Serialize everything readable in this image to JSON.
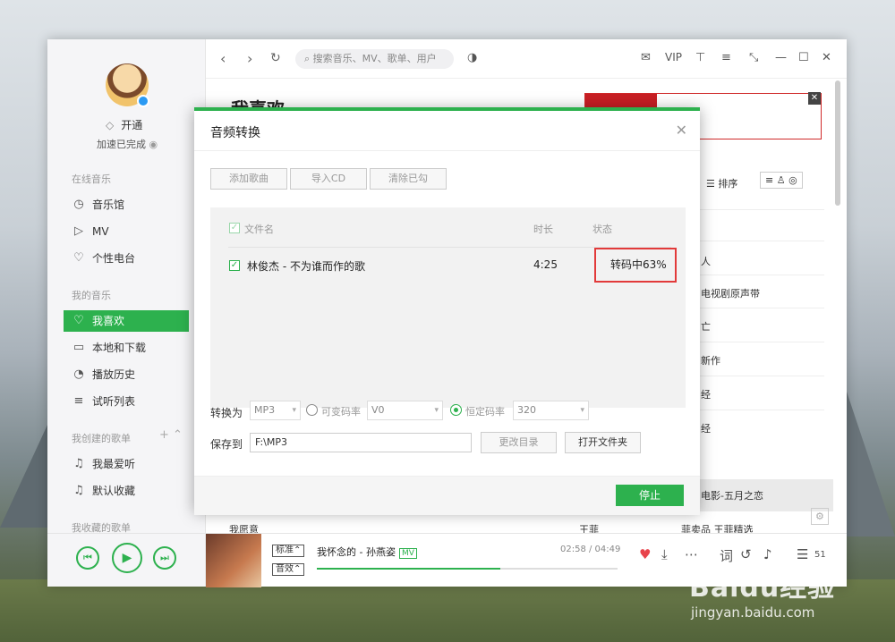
{
  "app": {
    "vip_label": "开通",
    "speed_label": "加速已完成",
    "sections": {
      "online": "在线音乐",
      "mine": "我的音乐",
      "created": "我创建的歌单",
      "collected": "我收藏的歌单"
    },
    "online_items": [
      {
        "label": "音乐馆",
        "icon": "music-hall-icon"
      },
      {
        "label": "MV",
        "icon": "mv-icon"
      },
      {
        "label": "个性电台",
        "icon": "radio-icon"
      }
    ],
    "my_items": [
      {
        "label": "我喜欢",
        "icon": "heart-icon"
      },
      {
        "label": "本地和下载",
        "icon": "computer-icon"
      },
      {
        "label": "播放历史",
        "icon": "clock-icon"
      },
      {
        "label": "试听列表",
        "icon": "playlist-icon"
      }
    ],
    "created_items": [
      {
        "label": "我最爱听",
        "icon": "music-note-icon"
      },
      {
        "label": "默认收藏",
        "icon": "music-note-icon"
      }
    ],
    "accent_color": "#2db14e"
  },
  "topbar": {
    "search_placeholder": "搜索音乐、MV、歌单、用户",
    "vip": "VIP"
  },
  "page": {
    "title": "我喜欢",
    "sort_label": "排序",
    "right_rows": [
      "人",
      "电视剧原声带",
      "亡",
      "新作",
      "经",
      "经"
    ],
    "highlight_row": "电影-五月之恋",
    "bottom_row_song": "我愿意",
    "bottom_row_artist": "王菲",
    "bottom_row_album": "菲卖品 王菲精选"
  },
  "player": {
    "song": "我怀念的 - 孙燕姿",
    "mv_tag": "MV",
    "quality_tag": "标准",
    "effect_tag": "音效",
    "time": "02:58 / 04:49",
    "progress_fraction": 0.61,
    "lyric_label": "词",
    "count": "51"
  },
  "dialog": {
    "title": "音频转换",
    "buttons": [
      "添加歌曲",
      "导入CD",
      "清除已勾"
    ],
    "columns": {
      "name": "文件名",
      "duration": "时长",
      "status": "状态"
    },
    "file": {
      "name": "林俊杰 - 不为谁而作的歌",
      "duration": "4:25",
      "status": "转码中63%"
    },
    "convert_label": "转换为",
    "format": "MP3",
    "vbr_label": "可变码率",
    "vbr_value": "V0",
    "cbr_label": "恒定码率",
    "cbr_value": "320",
    "save_label": "保存到",
    "save_path": "F:\\MP3",
    "change_dir": "更改目录",
    "open_folder": "打开文件夹",
    "stop": "停止"
  },
  "watermark": {
    "line1": "Baidu经验",
    "line2": "jingyan.baidu.com"
  }
}
